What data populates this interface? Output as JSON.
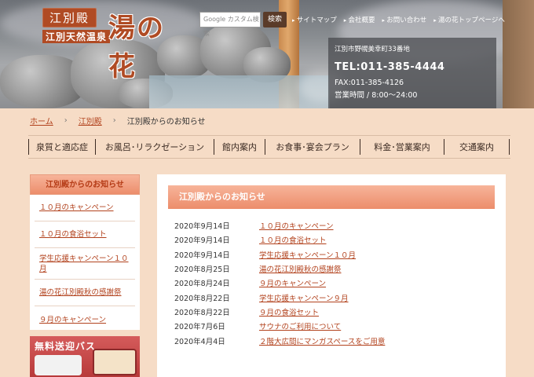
{
  "header": {
    "logo": {
      "tag": "江別殿",
      "sub": "江別天然温泉",
      "name": "湯の花"
    },
    "search": {
      "placeholder": "Google カスタム検索",
      "button": "検索"
    },
    "top_links": [
      "サイトマップ",
      "会社概要",
      "お問い合わせ",
      "湯の花トップページへ"
    ],
    "info": {
      "address": "江別市野幌美幸町33番地",
      "tel": "TEL:011-385-4444",
      "fax": "FAX:011-385-4126",
      "hours": "営業時間 / 8:00～24:00"
    }
  },
  "breadcrumb": {
    "home": "ホーム",
    "sep": "›",
    "level1": "江別殿",
    "current": "江別殿からのお知らせ"
  },
  "global_nav": [
    "泉質と適応症",
    "お風呂･リラクゼーション",
    "館内案内",
    "お食事･宴会プラン",
    "料金･営業案内",
    "交通案内"
  ],
  "sidebar": {
    "heading": "江別殿からのお知らせ",
    "items": [
      "１０月のキャンペーン",
      "１０月の食浴セット",
      "学生応援キャンペーン１０月",
      "湯の花江別殿秋の感謝祭",
      "９月のキャンペーン"
    ],
    "banner": "無料送迎バス"
  },
  "main": {
    "heading": "江別殿からのお知らせ",
    "news": [
      {
        "date": "2020年9月14日",
        "title": "１０月のキャンペーン"
      },
      {
        "date": "2020年9月14日",
        "title": "１０月の食浴セット"
      },
      {
        "date": "2020年9月14日",
        "title": "学生応援キャンペーン１０月"
      },
      {
        "date": "2020年8月25日",
        "title": "湯の花江別殿秋の感謝祭"
      },
      {
        "date": "2020年8月24日",
        "title": "９月のキャンペーン"
      },
      {
        "date": "2020年8月22日",
        "title": "学生応援キャンペーン９月"
      },
      {
        "date": "2020年8月22日",
        "title": "９月の食浴セット"
      },
      {
        "date": "2020年7月6日",
        "title": "サウナのご利用について"
      },
      {
        "date": "2020年4月4日",
        "title": "２階大広間にマンガスペースをご用意"
      }
    ]
  },
  "colors": {
    "accent": "#b2421d",
    "heading_bg": "#ec8d6b",
    "page_bg": "#f6dcc6",
    "nav_text": "#3b2a22"
  }
}
